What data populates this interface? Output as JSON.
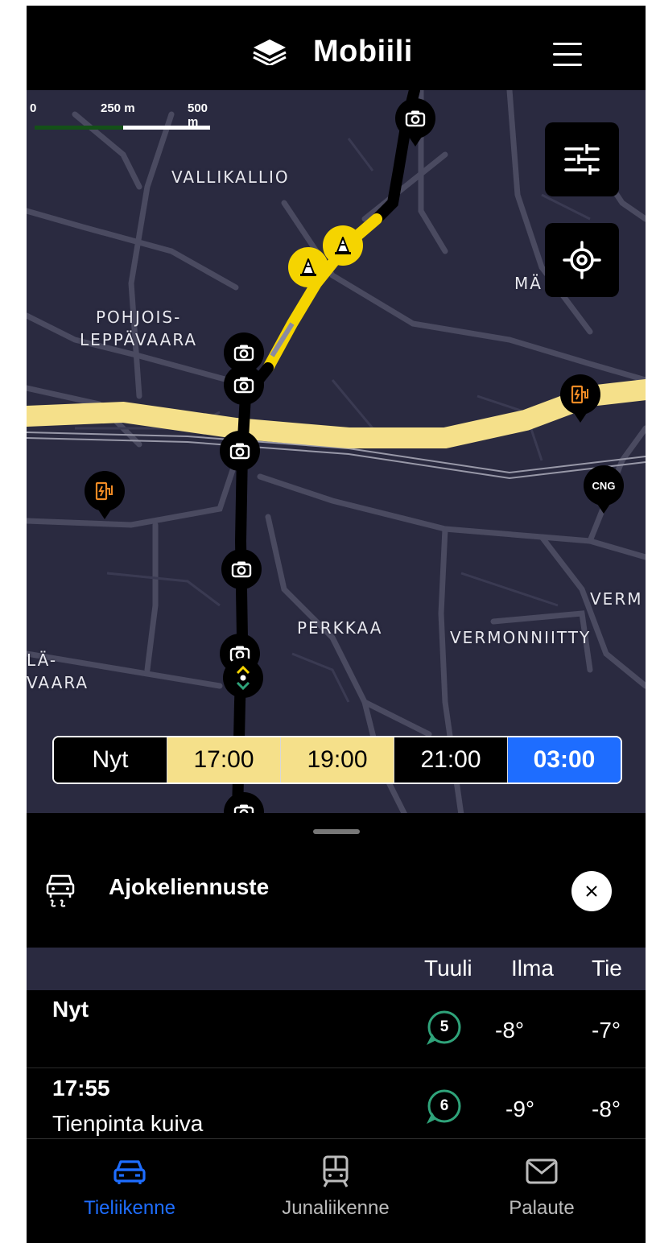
{
  "header": {
    "brand": "Mobiili"
  },
  "map": {
    "scale": {
      "labels": [
        "0",
        "250 m",
        "500 m"
      ]
    },
    "places": {
      "vallikallio": "VALLIKALLIO",
      "pohjois": "POHJOIS-",
      "leppavaara": "LEPPÄVAARA",
      "ma": "MÄ",
      "perkkaa": "PERKKAA",
      "vermonniitty": "VERMONNIITTY",
      "verm": "VERM",
      "la": "LÄ-",
      "vaara": "VAARA"
    },
    "cng_label": "CNG"
  },
  "timebar": {
    "segments": [
      {
        "label": "Nyt"
      },
      {
        "label": "17:00"
      },
      {
        "label": "19:00"
      },
      {
        "label": "21:00"
      },
      {
        "label": "03:00"
      }
    ]
  },
  "sheet": {
    "title": "Ajokeliennuste",
    "columns": {
      "wind": "Tuuli",
      "air": "Ilma",
      "road": "Tie"
    },
    "rows": [
      {
        "time": "Nyt",
        "desc": "",
        "wind": "5",
        "air": "-8°",
        "road": "-7°"
      },
      {
        "time": "17:55",
        "desc": "Tienpinta kuiva",
        "wind": "6",
        "air": "-9°",
        "road": "-8°"
      }
    ]
  },
  "nav": {
    "road": "Tieliikenne",
    "train": "Junaliikenne",
    "feedback": "Palaute"
  },
  "colors": {
    "accent_blue": "#1e6dff",
    "road_yellow": "#f5e08a",
    "warning_yellow": "#f5d400",
    "map_bg": "#2a2a40",
    "wind_green": "#2fa37a",
    "ev_orange": "#f08a24"
  }
}
